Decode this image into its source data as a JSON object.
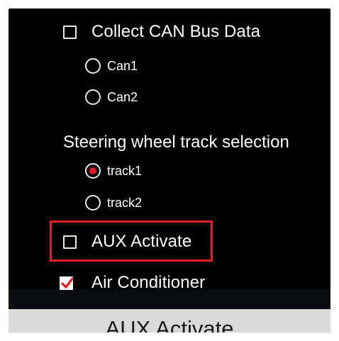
{
  "settings": {
    "collect_can": {
      "label": "Collect CAN Bus Data",
      "checked": false
    },
    "can_options": [
      {
        "label": "Can1",
        "selected": false
      },
      {
        "label": "Can2",
        "selected": false
      }
    ],
    "steering_heading": "Steering wheel track selection",
    "track_options": [
      {
        "label": "track1",
        "selected": true
      },
      {
        "label": "track2",
        "selected": false
      }
    ],
    "aux_activate": {
      "label": "AUX Activate",
      "checked": false,
      "highlighted": true
    },
    "air_conditioner": {
      "label": "Air Conditioner",
      "checked": true
    }
  },
  "caption": "AUX Activate",
  "colors": {
    "panel_background": "#000000",
    "accent_red": "#e51c23",
    "highlight_border": "#e0201c",
    "caption_bar": "#d9d9d9"
  }
}
